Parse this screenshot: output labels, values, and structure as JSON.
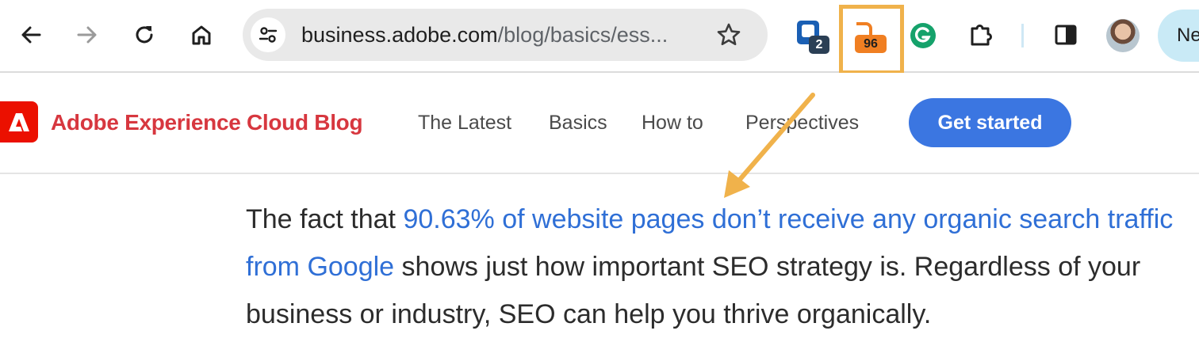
{
  "browser": {
    "url_host": "business.adobe.com",
    "url_path": "/blog/basics/ess...",
    "extensions": [
      {
        "name": "bitwarden",
        "badge": "2",
        "color": "#1a5fb4"
      },
      {
        "name": "ahrefs",
        "badge": "96",
        "color": "#f07f22",
        "highlighted": true
      },
      {
        "name": "grammarly",
        "color": "#15a26b"
      }
    ],
    "profile_label": "Ne"
  },
  "site": {
    "brand": "Adobe Experience Cloud Blog",
    "logo_letter": "A",
    "nav": [
      "The Latest",
      "Basics",
      "How to",
      "Perspectives"
    ],
    "cta": "Get started"
  },
  "article": {
    "lead": "The fact that ",
    "link": "90.63% of website pages don’t receive any organic search traffic from Google",
    "rest": " shows just how important SEO strategy is. Regardless of your business or industry, SEO can help you thrive organically."
  },
  "colors": {
    "highlight": "#f0b24b",
    "brand_red": "#d7373f",
    "cta_blue": "#3b76e1",
    "link_blue": "#2f6fd6"
  }
}
